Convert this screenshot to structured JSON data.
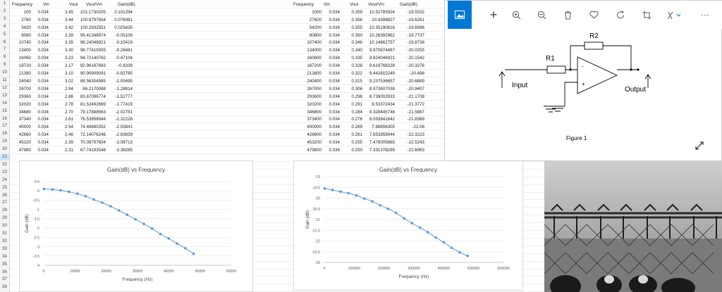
{
  "left_table": {
    "headers": [
      "Frequency",
      "Vin",
      "Vout",
      "Vout/Vin",
      "Gain(dB)"
    ],
    "rows": [
      [
        "100",
        "0.034",
        "3.45",
        "101.1730205",
        "0.101294"
      ],
      [
        "2760",
        "0.034",
        "3.44",
        "100.8797654",
        "0.076081"
      ],
      [
        "5420",
        "0.034",
        "3.42",
        "100.2932551",
        "0.025435"
      ],
      [
        "8080",
        "0.034",
        "3.39",
        "99.41348974",
        "-0.05109"
      ],
      [
        "10740",
        "0.034",
        "3.35",
        "98.24046921",
        "-0.15419"
      ],
      [
        "13400",
        "0.034",
        "3.30",
        "96.77419355",
        "-0.28481"
      ],
      [
        "16060",
        "0.034",
        "3.23",
        "94.72140762",
        "-0.47104"
      ],
      [
        "18720",
        "0.034",
        "3.17",
        "92.96187683",
        "-0.6339"
      ],
      [
        "21380",
        "0.034",
        "3.10",
        "90.90909091",
        "-0.82785"
      ],
      [
        "24040",
        "0.034",
        "3.02",
        "88.56304985",
        "-1.05495"
      ],
      [
        "26700",
        "0.034",
        "2.94",
        "86.2170088",
        "-1.28814"
      ],
      [
        "29360",
        "0.034",
        "2.86",
        "83.87096774",
        "-1.52777"
      ],
      [
        "32020",
        "0.034",
        "2.78",
        "81.52492669",
        "-1.77419"
      ],
      [
        "34680",
        "0.034",
        "2.70",
        "79.17888563",
        "-2.02781"
      ],
      [
        "37340",
        "0.034",
        "2.61",
        "76.53958944",
        "-2.32228"
      ],
      [
        "40000",
        "0.034",
        "2.54",
        "74.48680352",
        "-2.55841"
      ],
      [
        "42660",
        "0.034",
        "2.46",
        "72.14076246",
        "-2.83639"
      ],
      [
        "45320",
        "0.034",
        "2.39",
        "70.08797654",
        "-3.08713"
      ],
      [
        "47980",
        "0.034",
        "2.31",
        "67.74193548",
        "-3.38285"
      ]
    ]
  },
  "right_table": {
    "headers": [
      "Frequency",
      "Vin",
      "Vout",
      "Vout/Vin",
      "Gain(dB)"
    ],
    "rows": [
      [
        "1000",
        "0.034",
        "0.359",
        "10.52785924",
        "-19.5532"
      ],
      [
        "27600",
        "0.034",
        "0.356",
        "10.4398827",
        "-19.6261"
      ],
      [
        "54200",
        "0.034",
        "0.355",
        "10.35190616",
        "-19.6996"
      ],
      [
        "80800",
        "0.034",
        "0.350",
        "10.26392962",
        "-19.7737"
      ],
      [
        "107400",
        "0.034",
        "0.346",
        "10.14662757",
        "-19.8736"
      ],
      [
        "134000",
        "0.034",
        "0.340",
        "9.970674487",
        "-20.0255"
      ],
      [
        "160600",
        "0.034",
        "0.335",
        "9.824046921",
        "-20.1542"
      ],
      [
        "187200",
        "0.034",
        "0.328",
        "9.618768328",
        "-20.3376"
      ],
      [
        "213800",
        "0.034",
        "0.322",
        "9.442815249",
        "-20.498"
      ],
      [
        "240400",
        "0.034",
        "0.315",
        "9.237536657",
        "-20.6889"
      ],
      [
        "267000",
        "0.034",
        "0.306",
        "8.973607038",
        "-20.9407"
      ],
      [
        "293600",
        "0.034",
        "0.298",
        "8.739002933",
        "-21.1708"
      ],
      [
        "320200",
        "0.034",
        "0.291",
        "8.53372434",
        "-21.3772"
      ],
      [
        "346800",
        "0.034",
        "0.284",
        "8.328445748",
        "-21.5887"
      ],
      [
        "373400",
        "0.034",
        "0.276",
        "8.093841642",
        "-21.8369"
      ],
      [
        "400000",
        "0.034",
        "0.269",
        "7.88856305",
        "-22.06"
      ],
      [
        "426600",
        "0.034",
        "0.261",
        "7.653958944",
        "-22.3223"
      ],
      [
        "453200",
        "0.034",
        "0.255",
        "7.478005865",
        "-22.5243"
      ],
      [
        "479800",
        "0.034",
        "0.250",
        "7.331378299",
        "-22.6963"
      ]
    ]
  },
  "row_numbers": [
    "1",
    "2",
    "3",
    "4",
    "5",
    "6",
    "7",
    "8",
    "9",
    "10",
    "11",
    "12",
    "13",
    "14",
    "15",
    "16",
    "17",
    "18",
    "19",
    "20",
    "21",
    "22",
    "23",
    "24",
    "25",
    "26",
    "27",
    "28",
    "29",
    "30",
    "31",
    "32",
    "33",
    "34",
    "35",
    "36",
    "37",
    "38"
  ],
  "selected_row": "21",
  "chart_data": [
    {
      "type": "scatter",
      "title": "Gain(dB) vs Frequency",
      "xlabel": "Frequency (Hz)",
      "ylabel": "Gain (dB)",
      "xlim": [
        0,
        60000
      ],
      "ylim": [
        -4,
        0.5
      ],
      "xticks": [
        "0",
        "10000",
        "20000",
        "30000",
        "40000",
        "50000",
        "60000"
      ],
      "yticks": [
        "0.5",
        "0",
        "-0.5",
        "-1",
        "-1.5",
        "-2",
        "-2.5",
        "-3",
        "-3.5",
        "-4"
      ],
      "x": [
        100,
        2760,
        5420,
        8080,
        10740,
        13400,
        16060,
        18720,
        21380,
        24040,
        26700,
        29360,
        32020,
        34680,
        37340,
        40000,
        42660,
        45320,
        47980
      ],
      "y": [
        0.101294,
        0.076081,
        0.025435,
        -0.05109,
        -0.15419,
        -0.28481,
        -0.47104,
        -0.6339,
        -0.82785,
        -1.05495,
        -1.28814,
        -1.52777,
        -1.77419,
        -2.02781,
        -2.32228,
        -2.55841,
        -2.83639,
        -3.08713,
        -3.38285
      ],
      "color": "#5b9bd5"
    },
    {
      "type": "scatter",
      "title": "Gain(dB) vs Frequency",
      "xlabel": "Frequency (Hz)",
      "ylabel": "Gain (dB)",
      "xlim": [
        0,
        600000
      ],
      "ylim": [
        -23,
        -19
      ],
      "xticks": [
        "0",
        "100000",
        "200000",
        "300000",
        "400000",
        "500000",
        "600000"
      ],
      "yticks": [
        "-19",
        "-19.5",
        "-20",
        "-20.5",
        "-21",
        "-21.5",
        "-22",
        "-22.5",
        "-23"
      ],
      "x": [
        1000,
        27600,
        54200,
        80800,
        107400,
        134000,
        160600,
        187200,
        213800,
        240400,
        267000,
        293600,
        320200,
        346800,
        373400,
        400000,
        426600,
        453200,
        479800
      ],
      "y": [
        -19.5532,
        -19.6261,
        -19.6996,
        -19.7737,
        -19.8736,
        -20.0255,
        -20.1542,
        -20.3376,
        -20.498,
        -20.6889,
        -20.9407,
        -21.1708,
        -21.3772,
        -21.5887,
        -21.8369,
        -22.06,
        -22.3223,
        -22.5243,
        -22.6963
      ],
      "color": "#5b9bd5"
    }
  ],
  "viewer": {
    "toolbar": [
      "image-icon",
      "plus-icon",
      "zoom-in-icon",
      "zoom-out-icon",
      "trash-icon",
      "heart-icon",
      "rotate-icon",
      "crop-icon",
      "edit-icon",
      "more-icon"
    ],
    "more_label": "···",
    "figure_caption": "Figure 1",
    "labels": {
      "r1": "R1",
      "r2": "R2",
      "input": "Input",
      "output": "Output",
      "minus": "-",
      "plus": "+"
    }
  }
}
